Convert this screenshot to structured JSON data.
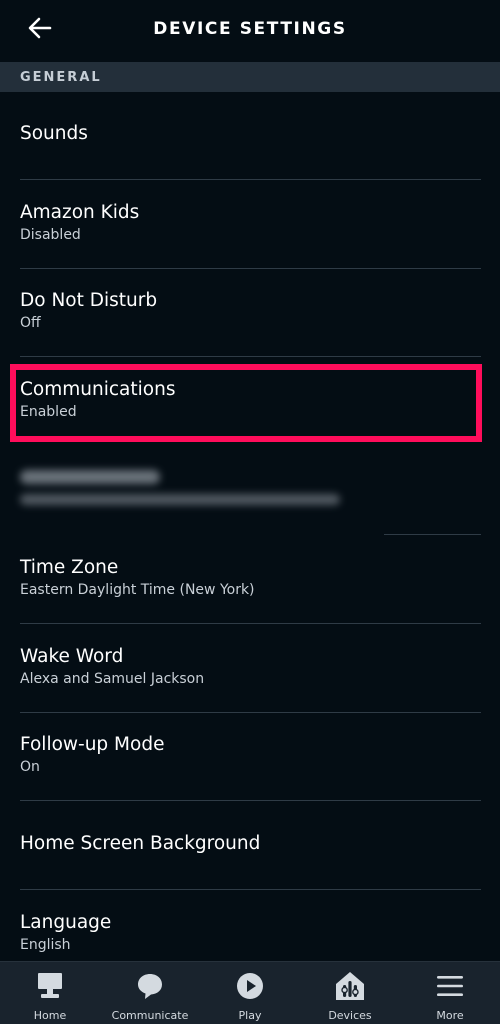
{
  "header": {
    "title": "DEVICE SETTINGS"
  },
  "section": {
    "label": "GENERAL"
  },
  "items": [
    {
      "title": "Sounds",
      "subtitle": ""
    },
    {
      "title": "Amazon Kids",
      "subtitle": "Disabled"
    },
    {
      "title": "Do Not Disturb",
      "subtitle": "Off"
    },
    {
      "title": "Communications",
      "subtitle": "Enabled"
    },
    {
      "title": "Time Zone",
      "subtitle": "Eastern Daylight Time (New York)"
    },
    {
      "title": "Wake Word",
      "subtitle": "Alexa and Samuel Jackson"
    },
    {
      "title": "Follow-up Mode",
      "subtitle": "On"
    },
    {
      "title": "Home Screen Background",
      "subtitle": ""
    },
    {
      "title": "Language",
      "subtitle": "English"
    }
  ],
  "nav": [
    {
      "label": "Home",
      "icon": "home-icon"
    },
    {
      "label": "Communicate",
      "icon": "chat-bubble-icon"
    },
    {
      "label": "Play",
      "icon": "play-icon"
    },
    {
      "label": "Devices",
      "icon": "devices-icon"
    },
    {
      "label": "More",
      "icon": "menu-icon"
    }
  ],
  "colors": {
    "background": "#040d14",
    "section": "#232f3a",
    "highlight": "#ff0d5b",
    "nav": "#19232d"
  }
}
